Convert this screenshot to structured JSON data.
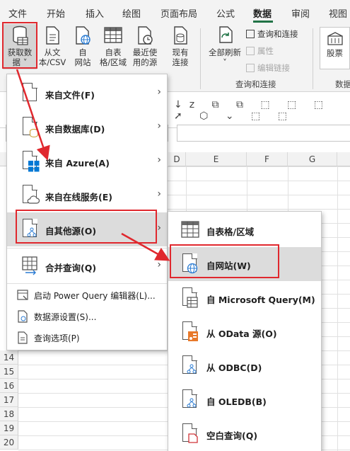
{
  "tabs": [
    "文件",
    "开始",
    "插入",
    "绘图",
    "页面布局",
    "公式",
    "数据",
    "审阅",
    "视图"
  ],
  "active_tab": "数据",
  "ribbon": {
    "get_data": {
      "line1": "获取数",
      "line2": "据 ˅"
    },
    "from_text": {
      "line1": "从文",
      "line2": "本/CSV"
    },
    "from_web": {
      "line1": "自",
      "line2": "网站"
    },
    "from_table": {
      "line1": "自表",
      "line2": "格/区域"
    },
    "recent_sources": {
      "line1": "最近使",
      "line2": "用的源"
    },
    "existing_conn": {
      "line1": "现有",
      "line2": "连接"
    },
    "refresh_all": {
      "line1": "全部刷新",
      "line2": "˅"
    },
    "queries_connections": "查询和连接",
    "properties": "属性",
    "edit_links": "编辑链接",
    "group_queries": "查询和连接",
    "stocks": "股票",
    "group_data_types": "数据"
  },
  "columns": [
    "D",
    "E",
    "F",
    "G"
  ],
  "rows": [
    "14",
    "15",
    "16",
    "17",
    "18",
    "19",
    "20"
  ],
  "menu": {
    "items": [
      {
        "label": "来自文件(F)",
        "has_arrow": true
      },
      {
        "label": "来自数据库(D)",
        "has_arrow": true
      },
      {
        "label": "来自 Azure(A)",
        "has_arrow": true
      },
      {
        "label": "来自在线服务(E)",
        "has_arrow": true
      },
      {
        "label": "自其他源(O)",
        "has_arrow": true
      },
      {
        "label": "合并查询(Q)",
        "has_arrow": true
      }
    ],
    "small_items": [
      {
        "label": "启动 Power Query 编辑器(L)..."
      },
      {
        "label": "数据源设置(S)..."
      },
      {
        "label": "查询选项(P)"
      }
    ]
  },
  "submenu": {
    "items": [
      {
        "label": "自表格/区域"
      },
      {
        "label": "自网站(W)"
      },
      {
        "label": "自 Microsoft Query(M)"
      },
      {
        "label": "从 OData 源(O)"
      },
      {
        "label": "从 ODBC(D)"
      },
      {
        "label": "自 OLEDB(B)"
      },
      {
        "label": "空白查询(Q)"
      }
    ]
  },
  "colors": {
    "accent": "#217346",
    "annotation": "#e0282e",
    "highlight": "#dcdcdc"
  }
}
